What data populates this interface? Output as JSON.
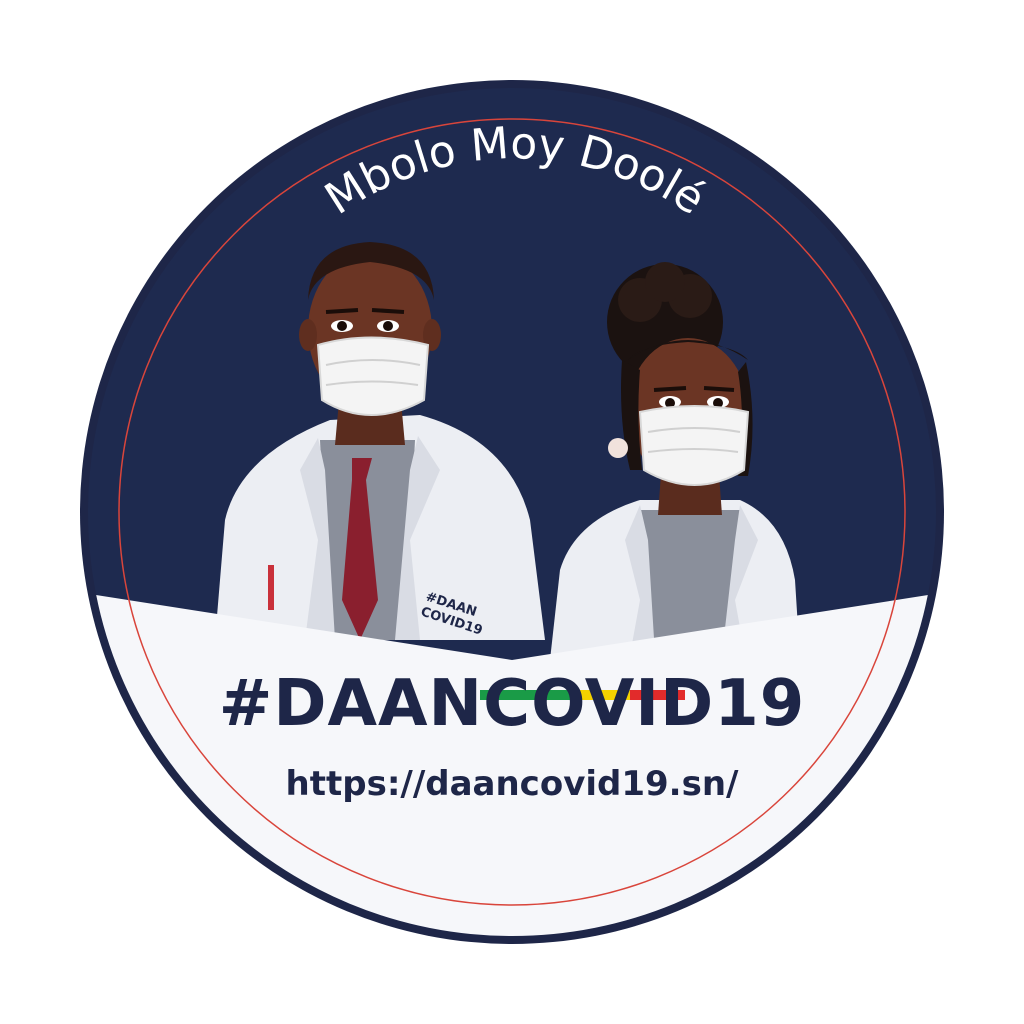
{
  "badge": {
    "slogan": "Mbolo Moy Doolé",
    "hashtag_prefix": "#DAAN",
    "hashtag_suffix": "COVID19",
    "url": "https://daancovid19.sn/",
    "coat_logo_line1": "#DAAN",
    "coat_logo_line2": "COVID19"
  },
  "colors": {
    "navy": "#1e2a4f",
    "ring": "#1e2648",
    "red_line": "#d9453b",
    "white_panel": "#f6f7fa",
    "skin": "#6b3524",
    "coat": "#eceef3",
    "shirt": "#8a8f9b",
    "tie": "#8a1f2e",
    "mask": "#f4f4f4",
    "flag_green": "#1a9b47",
    "flag_yellow": "#f5d200",
    "flag_red": "#e22b2b"
  },
  "icons": {
    "figure_left": "male-doctor-illustration",
    "figure_right": "female-doctor-illustration",
    "flag": "senegal-flag-stripe"
  }
}
